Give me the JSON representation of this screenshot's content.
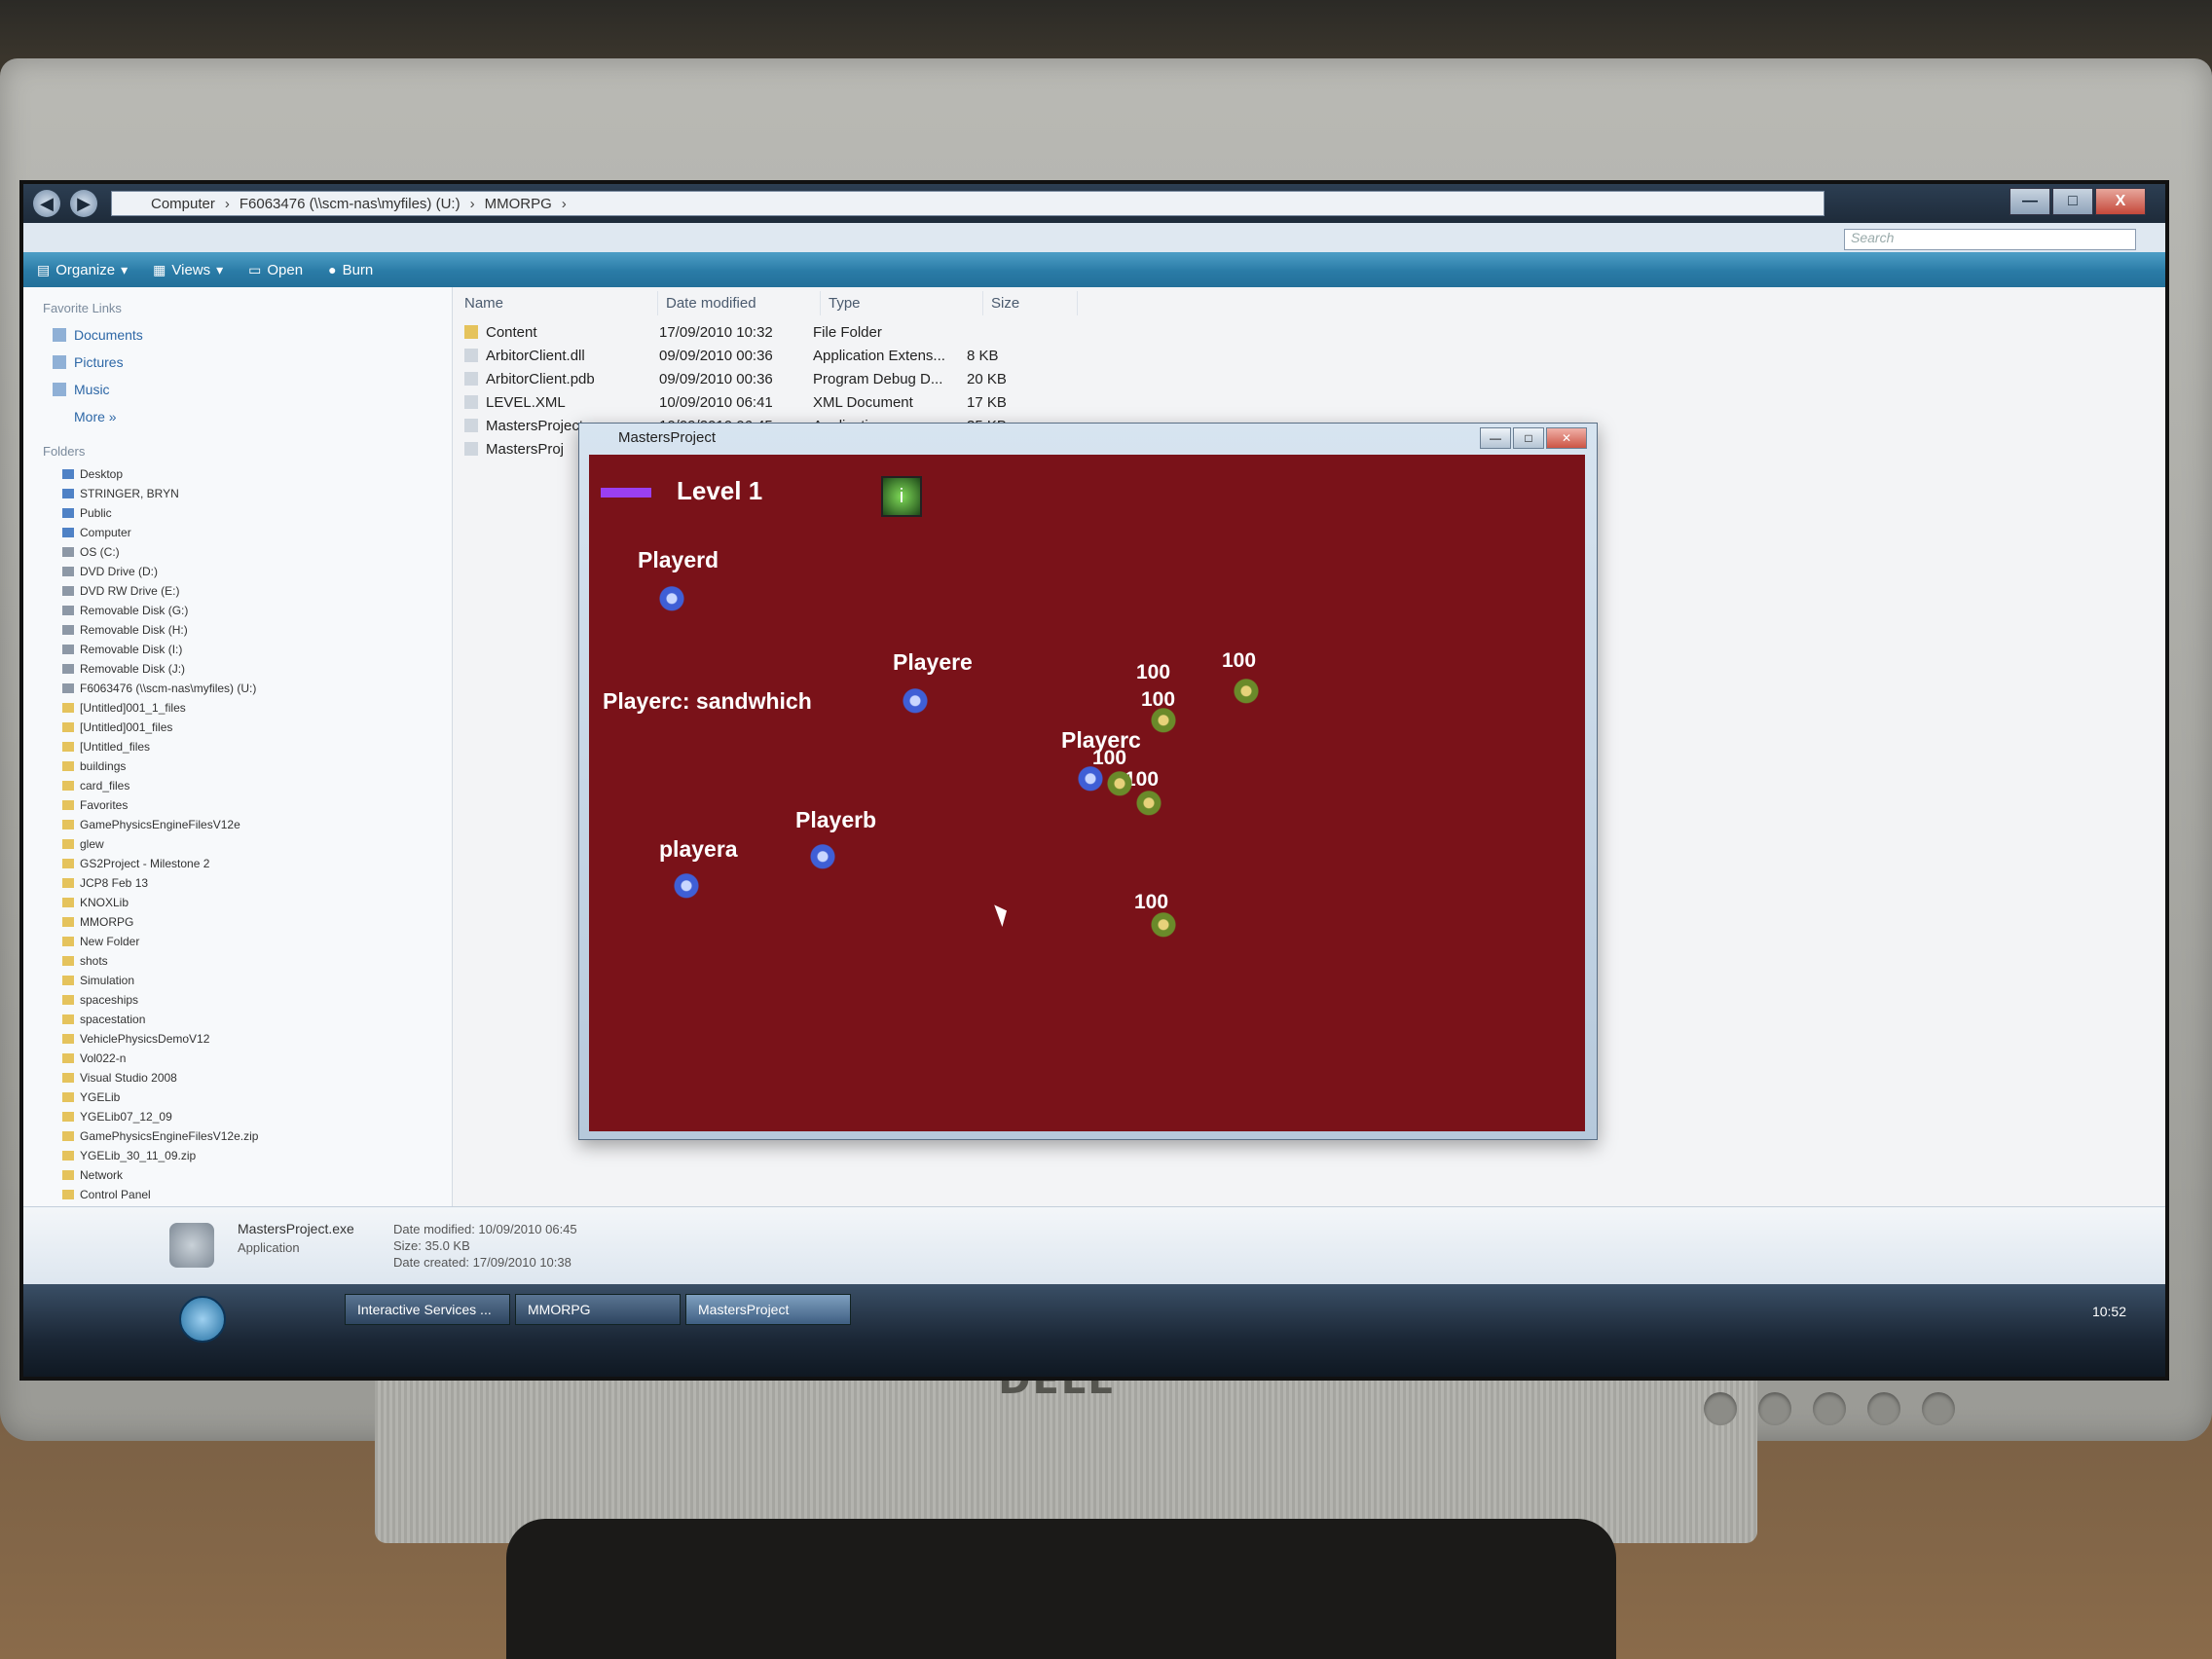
{
  "explorer": {
    "breadcrumb": [
      "Computer",
      "F6063476 (\\\\scm-nas\\myfiles) (U:)",
      "MMORPG"
    ],
    "search_placeholder": "Search",
    "window_controls": {
      "minimize": "—",
      "maximize": "□",
      "close": "X"
    },
    "toolbar": {
      "organize": "Organize",
      "views": "Views",
      "open": "Open",
      "burn": "Burn"
    },
    "favorite_links_header": "Favorite Links",
    "favorite_links": [
      "Documents",
      "Pictures",
      "Music",
      "More »"
    ],
    "folders_header": "Folders",
    "tree": [
      "Desktop",
      "STRINGER, BRYN",
      "Public",
      "Computer",
      "OS (C:)",
      "DVD Drive (D:)",
      "DVD RW Drive (E:)",
      "Removable Disk (G:)",
      "Removable Disk (H:)",
      "Removable Disk (I:)",
      "Removable Disk (J:)",
      "F6063476 (\\\\scm-nas\\myfiles) (U:)",
      "[Untitled]001_1_files",
      "[Untitled]001_files",
      "[Untitled_files",
      "buildings",
      "card_files",
      "Favorites",
      "GamePhysicsEngineFilesV12e",
      "glew",
      "GS2Project - Milestone 2",
      "JCP8 Feb 13",
      "KNOXLib",
      "MMORPG",
      "New Folder",
      "shots",
      "Simulation",
      "spaceships",
      "spacestation",
      "VehiclePhysicsDemoV12",
      "Vol022-n",
      "Visual Studio 2008",
      "YGELib",
      "YGELib07_12_09",
      "GamePhysicsEngineFilesV12e.zip",
      "YGELib_30_11_09.zip",
      "Network",
      "Control Panel"
    ],
    "columns": [
      "Name",
      "Date modified",
      "Type",
      "Size"
    ],
    "files": [
      {
        "name": "Content",
        "date": "17/09/2010 10:32",
        "type": "File Folder",
        "size": ""
      },
      {
        "name": "ArbitorClient.dll",
        "date": "09/09/2010 00:36",
        "type": "Application Extens...",
        "size": "8 KB"
      },
      {
        "name": "ArbitorClient.pdb",
        "date": "09/09/2010 00:36",
        "type": "Program Debug D...",
        "size": "20 KB"
      },
      {
        "name": "LEVEL.XML",
        "date": "10/09/2010 06:41",
        "type": "XML Document",
        "size": "17 KB"
      },
      {
        "name": "MastersProject.exe",
        "date": "10/09/2010 06:45",
        "type": "Application",
        "size": "35 KB"
      },
      {
        "name": "MastersProj",
        "date": "",
        "type": "",
        "size": ""
      }
    ],
    "details": {
      "name": "MastersProject.exe",
      "type": "Application",
      "meta": [
        "Date modified: 10/09/2010 06:45",
        "Size: 35.0 KB",
        "Date created: 17/09/2010 10:38"
      ]
    }
  },
  "taskbar": {
    "buttons": [
      "Interactive Services ...",
      "MMORPG",
      "MastersProject"
    ],
    "clock": "10:52"
  },
  "game": {
    "window_title": "MastersProject",
    "level_label": "Level 1",
    "hud_icon": "i",
    "players": [
      "Playerd",
      "Playere",
      "Playerc: sandwhich",
      "Playerc",
      "Playerb",
      "playera"
    ],
    "health_values": [
      "100",
      "100",
      "100",
      "100",
      "100",
      "100"
    ]
  },
  "monitor": {
    "brand": "DELL"
  },
  "icons": [
    "back-arrow-icon",
    "forward-arrow-icon",
    "folder-icon",
    "search-icon",
    "burn-icon"
  ]
}
